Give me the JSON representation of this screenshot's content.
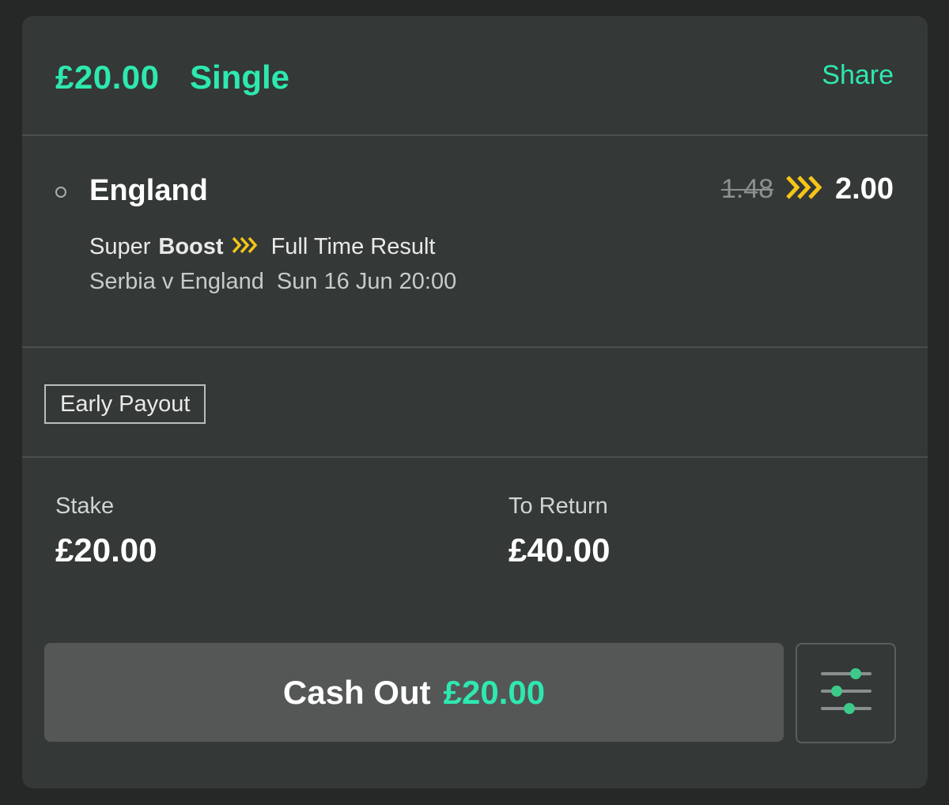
{
  "header": {
    "amount": "£20.00",
    "bet_type": "Single",
    "share_label": "Share"
  },
  "selection": {
    "name": "England",
    "old_odds": "1.48",
    "new_odds": "2.00",
    "boost_prefix": "Super",
    "boost_word": "Boost",
    "market": "Full Time Result",
    "event": "Serbia v England",
    "event_time": "Sun 16 Jun 20:00"
  },
  "early_payout_label": "Early Payout",
  "stake": {
    "label": "Stake",
    "value": "£20.00"
  },
  "to_return": {
    "label": "To Return",
    "value": "£40.00"
  },
  "cashout": {
    "label": "Cash Out",
    "value": "£20.00"
  },
  "icons": {
    "selection_status": "radio-circle-icon",
    "boost": "chevrons-right-icon",
    "settings": "sliders-icon"
  },
  "colors": {
    "accent_green": "#2ee8b0",
    "boost_yellow": "#f5c518",
    "card_bg": "#343837",
    "page_bg": "#262727",
    "button_bg": "#555757"
  }
}
